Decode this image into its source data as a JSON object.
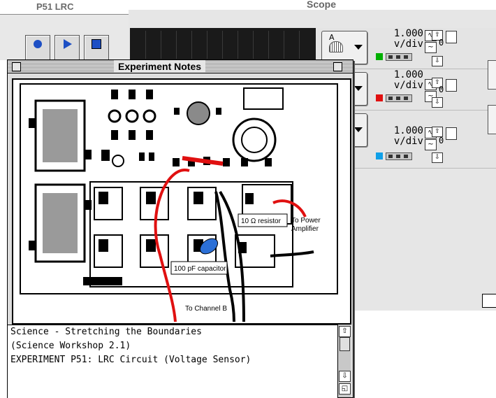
{
  "lrc_panel": {
    "title": "P51 LRC"
  },
  "scope": {
    "title": "Scope"
  },
  "channels": [
    {
      "label": "A",
      "scale_value": "1.000",
      "scale_unit": "v/div",
      "offset": "0",
      "color": "#00b000"
    },
    {
      "label": "",
      "scale_value": "1.000",
      "scale_unit": "v/div",
      "offset": "0",
      "color": "#e01010"
    },
    {
      "label": "",
      "scale_value": "1.000",
      "scale_unit": "v/div",
      "offset": "0",
      "color": "#10a0e8"
    }
  ],
  "notes": {
    "title": "Experiment Notes",
    "image_labels": {
      "resistor": "10 Ω resistor",
      "capacitor": "100 pF capacitor",
      "power": "To Power",
      "amplifier": "Amplifier",
      "channel": "To Channel B"
    },
    "lines": [
      "Science - Stretching the Boundaries",
      "(Science Workshop 2.1)",
      "",
      "EXPERIMENT P51: LRC Circuit (Voltage Sensor)"
    ]
  },
  "icons": {
    "record": "record-icon",
    "play": "play-icon",
    "stop": "stop-icon",
    "sensor": "sensor-icon",
    "wave": "wave-icon",
    "save": "save-icon"
  }
}
